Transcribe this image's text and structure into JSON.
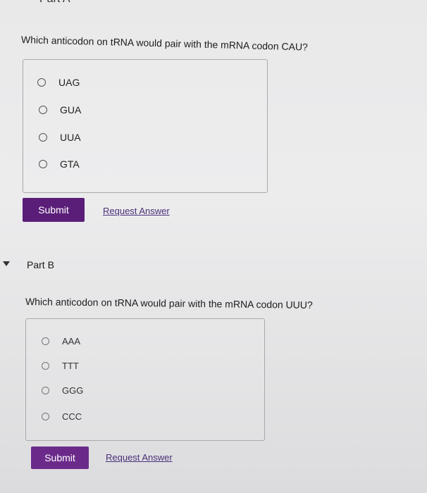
{
  "part_a": {
    "header": "Part A",
    "question": "Which anticodon on tRNA would pair with the mRNA codon CAU?",
    "options": [
      "UAG",
      "GUA",
      "UUA",
      "GTA"
    ],
    "submit_label": "Submit",
    "request_answer_label": "Request Answer"
  },
  "part_b": {
    "header": "Part B",
    "question": "Which anticodon on tRNA would pair with the mRNA codon UUU?",
    "options": [
      "AAA",
      "TTT",
      "GGG",
      "CCC"
    ],
    "submit_label": "Submit",
    "request_answer_label": "Request Answer"
  },
  "colors": {
    "submit_button": "#5a1e78",
    "link": "#4a2f7a"
  }
}
